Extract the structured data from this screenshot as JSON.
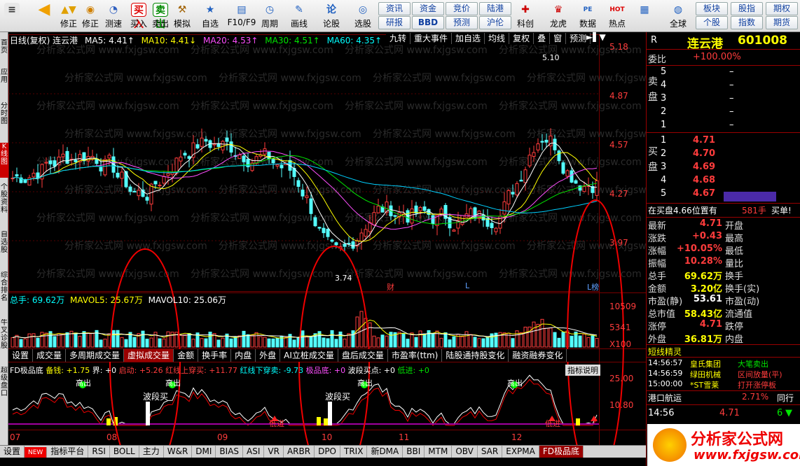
{
  "toolbar": {
    "buttons": [
      "买入",
      "卖出",
      "融资",
      "模拟",
      "自选",
      "F10/F9",
      "周期",
      "画线",
      "论股",
      "选股"
    ],
    "nav": [
      "修正",
      "测速"
    ],
    "small_top": [
      "资讯",
      "资金",
      "竞价",
      "陆港",
      "科创",
      "龙虎",
      "数据",
      "热点",
      "全球",
      "板块",
      "股指",
      "期权"
    ],
    "small_bottom": [
      "研报",
      "BBD",
      "预测",
      "沪伦",
      "科创",
      "龙虎",
      "数据",
      "热点",
      "全球",
      "个股",
      "指数",
      "期货"
    ],
    "icon_labels": [
      "PE",
      "HOT"
    ]
  },
  "side_tabs": [
    "首页",
    "应用",
    "分时图",
    "K线图",
    "个股资料",
    "自选股",
    "综合排名",
    "牛叉诊股",
    "超级盘口"
  ],
  "main": {
    "header": "日线(复权)  连云港",
    "ma5": "MA5: 4.41↑",
    "ma10": "MA10: 4.41↓",
    "ma20": "MA20: 4.53↑",
    "ma30": "MA30: 4.51↑",
    "ma60": "MA60: 4.35↑",
    "right_buttons": [
      "九转",
      "重大事件",
      "加自选",
      "均线",
      "复权",
      "叠",
      "窗",
      "预测"
    ],
    "price_axis": [
      "5.18",
      "4.87",
      "4.57",
      "4.27",
      "3.97"
    ],
    "high_label": "5.10",
    "low_label": "3.74",
    "markers": [
      "财",
      "L",
      "L榜"
    ],
    "watermark": "分析家公式网 www.fxjgsw.com"
  },
  "volume": {
    "header_total": "总手: 69.62万",
    "mavol5": "MAVOL5: 25.67万",
    "mavol10": "MAVOL10: 25.06万",
    "axis": [
      "10509",
      "5341",
      "X100"
    ]
  },
  "ind_tabs": [
    "设置",
    "成交量",
    "多周期成交量",
    "虚拟成交量",
    "金额",
    "换手率",
    "内盘",
    "外盘",
    "AI立桩成交量",
    "盘后成交量",
    "市盈率(ttm)",
    "陆股通持股变化",
    "融资融券变化"
  ],
  "indicator": {
    "header": "FD极品底",
    "items": [
      "备钱: +1.75",
      "界: +0",
      "启动: +5.26",
      "红线上穿买: +11.77",
      "红线下穿卖: -9.73",
      "极品底: +0",
      "波段买点: +0",
      "低进: +0"
    ],
    "help": "指标说明",
    "axis": [
      "25.00",
      "10.80"
    ],
    "labels": {
      "high": "高出",
      "wave": "波段买",
      "low": "低进"
    }
  },
  "date_axis": [
    "07",
    "08",
    "09",
    "10",
    "11",
    "12"
  ],
  "bottom_tabs": [
    "设置",
    "NEW",
    "指标平台",
    "RSI",
    "BOLL",
    "主力",
    "W&R",
    "DMI",
    "BIAS",
    "ASI",
    "VR",
    "ARBR",
    "DPO",
    "TRIX",
    "新DMA",
    "BBI",
    "MTM",
    "OBV",
    "SAR",
    "EXPMA",
    "FD极品底"
  ],
  "quote": {
    "R": "R",
    "name": "连云港",
    "code": "601008",
    "ratio_label": "委比",
    "ratio": "+100.00%",
    "sell": [
      [
        "5",
        "",
        ""
      ],
      [
        "4",
        "",
        ""
      ],
      [
        "3",
        "",
        ""
      ],
      [
        "2",
        "",
        ""
      ],
      [
        "1",
        "",
        ""
      ]
    ],
    "buy": [
      [
        "1",
        "4.71",
        ""
      ],
      [
        "2",
        "4.70",
        ""
      ],
      [
        "3",
        "4.69",
        ""
      ],
      [
        "4",
        "4.68",
        ""
      ],
      [
        "5",
        "4.67",
        ""
      ]
    ],
    "sell_label": "卖盘",
    "buy_label": "买盘",
    "notice": "在买盘4.66位置有",
    "notice_qty": "581手",
    "notice_tail": "买单!",
    "fields": [
      [
        "最新",
        "4.71",
        "开盘",
        ""
      ],
      [
        "涨跌",
        "+0.43",
        "最高",
        ""
      ],
      [
        "涨幅",
        "+10.05%",
        "最低",
        ""
      ],
      [
        "振幅",
        "10.28%",
        "量比",
        ""
      ],
      [
        "总手",
        "69.62万",
        "换手",
        ""
      ],
      [
        "金额",
        "3.20亿",
        "换手(实)",
        ""
      ],
      [
        "市盈(静)",
        "53.61",
        "市盈(动)",
        ""
      ],
      [
        "总市值",
        "58.43亿",
        "流通值",
        ""
      ],
      [
        "涨停",
        "4.71",
        "跌停",
        ""
      ],
      [
        "外盘",
        "36.81万",
        "内盘",
        ""
      ]
    ],
    "elf_title": "短线精灵",
    "elf": [
      [
        "14:56:57",
        "皇氏集团",
        "大笔卖出"
      ],
      [
        "14:56:59",
        "绿田机械",
        "区间放量(平)"
      ],
      [
        "15:00:00",
        "*ST雪莱",
        "打开涨停板"
      ]
    ],
    "sector": "港口航运",
    "sector_pct": "2.71%",
    "sector_tail": "同行",
    "tick": [
      "14:56",
      "4.71",
      "6"
    ]
  },
  "brand": {
    "name": "分析家公式网",
    "url": "www.fxjgsw.com"
  }
}
